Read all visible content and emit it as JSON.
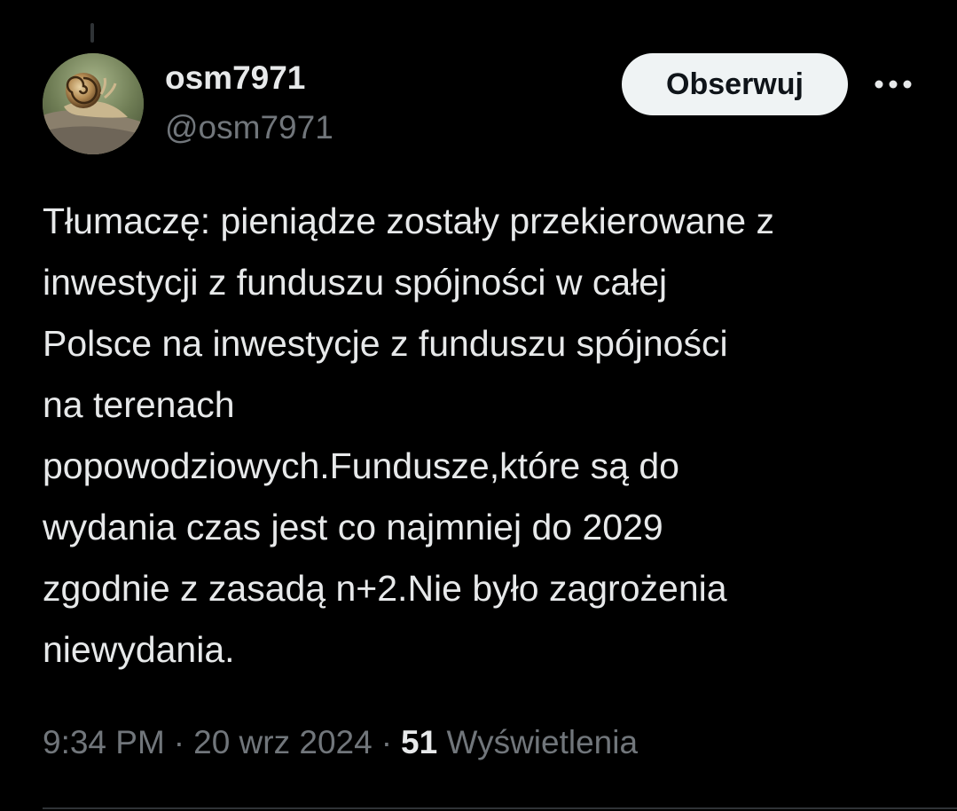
{
  "author": {
    "display_name": "osm7971",
    "handle": "@osm7971",
    "avatar_icon": "snail-photo"
  },
  "actions": {
    "follow_label": "Obserwuj",
    "more_icon": "more-horizontal-icon"
  },
  "tweet": {
    "text": "Tłumaczę: pieniądze zostały przekierowane z\ninwestycji z funduszu spójności w całej\nPolsce na inwestycje z funduszu spójności\nna terenach\npopowodziowych.Fundusze,które są do\nwydania czas jest co najmniej do 2029\nzgodnie z zasadą n+2.Nie było zagrożenia\nniewydania."
  },
  "meta": {
    "time": "9:34 PM",
    "date": "20 wrz 2024",
    "separator": "·",
    "views_count": "51",
    "views_label": "Wyświetlenia"
  },
  "colors": {
    "background": "#000000",
    "primary_text": "#e7e9ea",
    "secondary_text": "#71767b",
    "follow_button_bg": "#eff3f4"
  }
}
